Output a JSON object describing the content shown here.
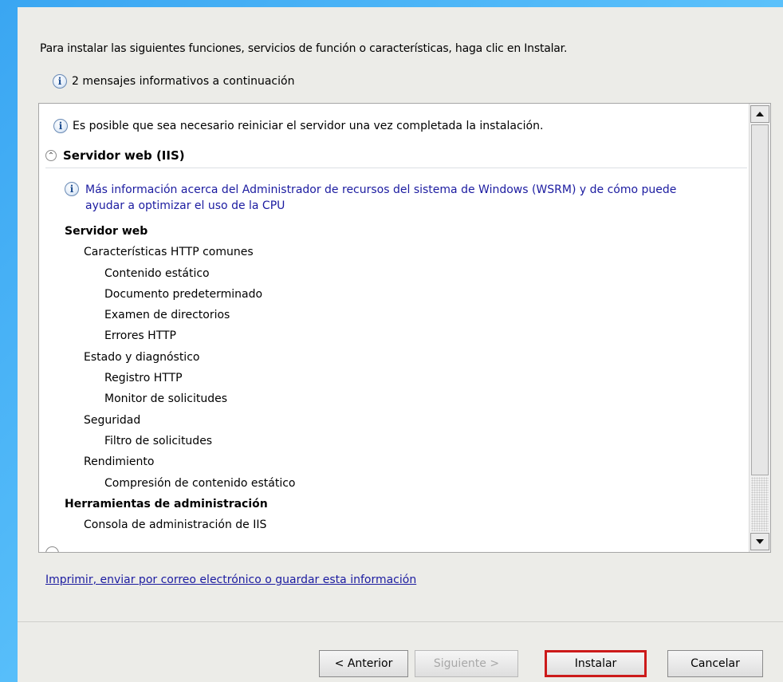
{
  "intro_text": "Para instalar las siguientes funciones, servicios de función o características, haga clic en Instalar.",
  "info_count_text": "2 mensajes informativos a continuación",
  "panel": {
    "restart_warning": "Es posible que sea necesario reiniciar el servidor una vez completada la instalación.",
    "section_title": "Servidor web (IIS)",
    "more_info_link": "Más información acerca del Administrador de recursos del sistema de Windows (WSRM) y de cómo puede ayudar a optimizar el uso de la CPU",
    "tree": [
      {
        "label": "Servidor web",
        "level": 0
      },
      {
        "label": "Características HTTP comunes",
        "level": 1
      },
      {
        "label": "Contenido estático",
        "level": 2
      },
      {
        "label": "Documento predeterminado",
        "level": 2
      },
      {
        "label": "Examen de directorios",
        "level": 2
      },
      {
        "label": "Errores HTTP",
        "level": 2
      },
      {
        "label": "Estado y diagnóstico",
        "level": 1
      },
      {
        "label": "Registro HTTP",
        "level": 2
      },
      {
        "label": "Monitor de solicitudes",
        "level": 2
      },
      {
        "label": "Seguridad",
        "level": 1
      },
      {
        "label": "Filtro de solicitudes",
        "level": 2
      },
      {
        "label": "Rendimiento",
        "level": 1
      },
      {
        "label": "Compresión de contenido estático",
        "level": 2
      },
      {
        "label": "Herramientas de administración",
        "level": 0
      },
      {
        "label": "Consola de administración de IIS",
        "level": 1
      }
    ]
  },
  "print_link": "Imprimir, enviar por correo electrónico o guardar esta información",
  "buttons": {
    "back": "< Anterior",
    "next": "Siguiente >",
    "install": "Instalar",
    "cancel": "Cancelar"
  },
  "colors": {
    "link": "#1b1ba0",
    "focus_border": "#cc1a1a"
  }
}
